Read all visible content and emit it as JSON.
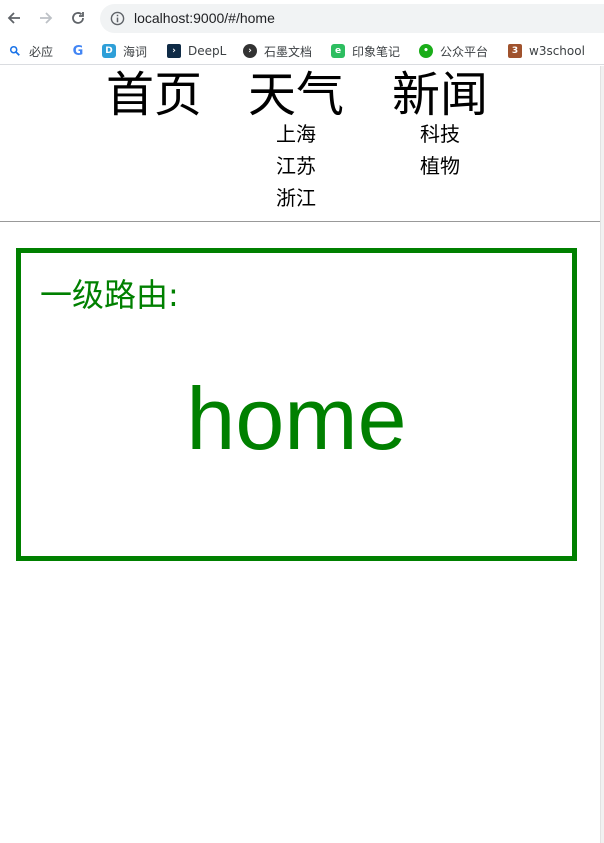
{
  "browser": {
    "url": "localhost:9000/#/home",
    "bookmarks": [
      {
        "label": "必应",
        "icon": "search-icon",
        "color": "#1a73e8"
      },
      {
        "label": "",
        "icon": "google-icon",
        "color": "#4285f4"
      },
      {
        "label": "海词",
        "icon": "dict-icon",
        "color": "#2e9fd8"
      },
      {
        "label": "DeepL",
        "icon": "deepl-icon",
        "color": "#0f2b46"
      },
      {
        "label": "石墨文档",
        "icon": "shimo-icon",
        "color": "#333333"
      },
      {
        "label": "印象笔记",
        "icon": "evernote-icon",
        "color": "#2dbe60"
      },
      {
        "label": "公众平台",
        "icon": "wechat-icon",
        "color": "#1aad19"
      },
      {
        "label": "w3school",
        "icon": "w3school-icon",
        "color": "#a0522d"
      }
    ]
  },
  "menu": {
    "home": {
      "label": "首页"
    },
    "weather": {
      "label": "天气",
      "items": [
        "上海",
        "江苏",
        "浙江"
      ]
    },
    "news": {
      "label": "新闻",
      "items": [
        "科技",
        "植物"
      ]
    }
  },
  "content": {
    "label": "一级路由:",
    "route": "home",
    "accent_color": "#008000"
  }
}
